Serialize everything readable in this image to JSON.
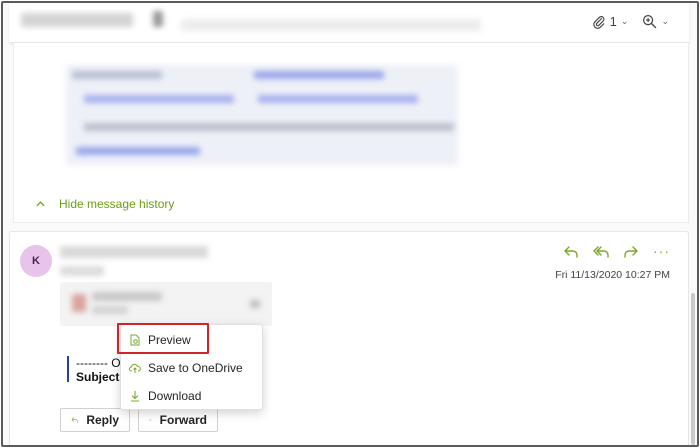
{
  "toolbar": {
    "attachment_count": "1",
    "icons": [
      "paperclip-icon",
      "zoom-icon"
    ]
  },
  "history": {
    "hide_label": "Hide message history"
  },
  "message": {
    "avatar_initial": "K",
    "date": "Fri 11/13/2020 10:27 PM",
    "quote_line1": "-------- O",
    "quote_line2": "Subject:",
    "more_label": "···",
    "reply_label": "Reply",
    "forward_label": "Forward"
  },
  "context_menu": {
    "items": [
      {
        "label": "Preview",
        "icon": "preview-icon"
      },
      {
        "label": "Save to OneDrive",
        "icon": "cloud-upload-icon"
      },
      {
        "label": "Download",
        "icon": "download-icon"
      }
    ]
  },
  "colors": {
    "accent": "#7aa82a",
    "link_green": "#6b9e16",
    "highlight_red": "#d1232a",
    "avatar_bg": "#e8c4ea"
  }
}
